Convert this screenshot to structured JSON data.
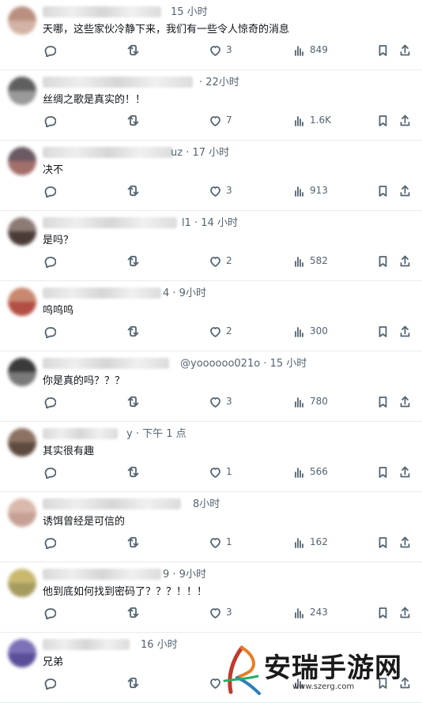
{
  "posts": [
    {
      "time": "15 小时",
      "text": "天哪，这些家伙冷静下来，我们有一些令人惊奇的消息",
      "likes": "3",
      "views": "849",
      "colors": [
        "#b98f80",
        "#d2b3a5"
      ]
    },
    {
      "time": "· 22小时",
      "text": "丝绸之歌是真实的！！",
      "likes": "7",
      "views": "1.6K",
      "colors": [
        "#5f5f5f",
        "#9a9a9a"
      ]
    },
    {
      "time": "uz · 17 小时",
      "text": "决不",
      "likes": "3",
      "views": "913",
      "colors": [
        "#6b5a63",
        "#a36f6a"
      ]
    },
    {
      "time": "l1 · 14 小时",
      "text": "是吗？",
      "likes": "2",
      "views": "582",
      "colors": [
        "#8c7b74",
        "#4b3c38"
      ]
    },
    {
      "time": "4 · 9小时",
      "text": "呜呜呜",
      "likes": "2",
      "views": "300",
      "colors": [
        "#c98870",
        "#b34e43"
      ]
    },
    {
      "time": "@yoooooo021o · 15 小时",
      "text": "你是真的吗？？？",
      "likes": "3",
      "views": "780",
      "colors": [
        "#3a3a3a",
        "#7a7a7a"
      ]
    },
    {
      "time": "y · 下午 1 点",
      "text": "其实很有趣",
      "likes": "1",
      "views": "566",
      "colors": [
        "#8c7262",
        "#5e4b40"
      ]
    },
    {
      "time": "8小时",
      "text": "诱饵曾经是可信的",
      "likes": "1",
      "views": "162",
      "colors": [
        "#d9b9ac",
        "#c7a095"
      ]
    },
    {
      "time": "9 · 9小时",
      "text": "他到底如何找到密码了？？？！！！",
      "likes": "3",
      "views": "243",
      "colors": [
        "#c9b96f",
        "#a59b5f"
      ]
    },
    {
      "time": "16 小时",
      "text": "兄弟",
      "likes": "",
      "views": "",
      "colors": [
        "#7d72b8",
        "#5c4f99"
      ]
    }
  ],
  "icons": {
    "reply": "reply-icon",
    "retweet": "retweet-icon",
    "like": "heart-icon",
    "views": "views-icon",
    "bookmark": "bookmark-icon",
    "share": "share-icon"
  },
  "watermark": {
    "name": "安瑞手游网",
    "url": "www.szerg.com"
  }
}
